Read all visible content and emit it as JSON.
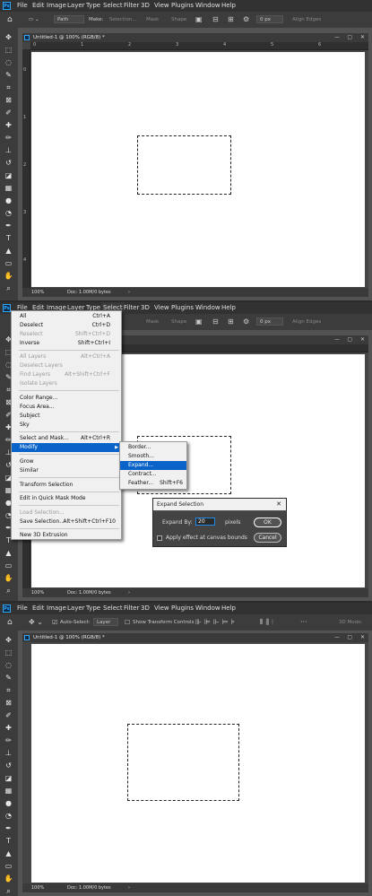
{
  "menu": [
    "File",
    "Edit",
    "Image",
    "Layer",
    "Type",
    "Select",
    "Filter",
    "3D",
    "View",
    "Plugins",
    "Window",
    "Help"
  ],
  "menu_logo": "Ps",
  "options_bar_1": {
    "path_label": "Path",
    "make_label": "Make:",
    "selection_btn": "Selection...",
    "mask_btn": "Mask",
    "shape_btn": "Shape",
    "radius_value": "0 px",
    "align_edges": "Align Edges"
  },
  "options_bar_3": {
    "auto_select": "Auto-Select:",
    "layer_value": "Layer",
    "show_transform": "Show Transform Controls",
    "mode_3d": "3D Mode:"
  },
  "document": {
    "title": "Untitled-1 @ 100% (RGB/8) *",
    "zoom": "100%",
    "doc_info": "Doc: 1.00M/0 bytes"
  },
  "ruler": {
    "top": [
      "0",
      "1",
      "2",
      "3",
      "4",
      "5",
      "6"
    ],
    "left": [
      "0",
      "1",
      "2",
      "3",
      "4"
    ]
  },
  "select_menu": [
    {
      "label": "All",
      "shortcut": "Ctrl+A",
      "state": "normal"
    },
    {
      "label": "Deselect",
      "shortcut": "Ctrl+D",
      "state": "normal"
    },
    {
      "label": "Reselect",
      "shortcut": "Shift+Ctrl+D",
      "state": "disabled"
    },
    {
      "label": "Inverse",
      "shortcut": "Shift+Ctrl+I",
      "state": "normal"
    },
    {
      "label": "All Layers",
      "shortcut": "Alt+Ctrl+A",
      "state": "disabled"
    },
    {
      "label": "Deselect Layers",
      "shortcut": "",
      "state": "disabled"
    },
    {
      "label": "Find Layers",
      "shortcut": "Alt+Shift+Ctrl+F",
      "state": "disabled"
    },
    {
      "label": "Isolate Layers",
      "shortcut": "",
      "state": "disabled"
    },
    {
      "label": "Color Range...",
      "shortcut": "",
      "state": "normal"
    },
    {
      "label": "Focus Area...",
      "shortcut": "",
      "state": "normal"
    },
    {
      "label": "Subject",
      "shortcut": "",
      "state": "normal"
    },
    {
      "label": "Sky",
      "shortcut": "",
      "state": "normal"
    },
    {
      "label": "Select and Mask...",
      "shortcut": "Alt+Ctrl+R",
      "state": "normal"
    },
    {
      "label": "Modify",
      "shortcut": "",
      "state": "highlighted"
    },
    {
      "label": "Grow",
      "shortcut": "",
      "state": "normal"
    },
    {
      "label": "Similar",
      "shortcut": "",
      "state": "normal"
    },
    {
      "label": "Transform Selection",
      "shortcut": "",
      "state": "normal"
    },
    {
      "label": "Edit in Quick Mask Mode",
      "shortcut": "",
      "state": "normal"
    },
    {
      "label": "Load Selection...",
      "shortcut": "",
      "state": "disabled"
    },
    {
      "label": "Save Selection...",
      "shortcut": "Alt+Shift+Ctrl+F10",
      "state": "normal"
    },
    {
      "label": "New 3D Extrusion",
      "shortcut": "",
      "state": "normal"
    }
  ],
  "modify_submenu": [
    {
      "label": "Border...",
      "shortcut": ""
    },
    {
      "label": "Smooth...",
      "shortcut": ""
    },
    {
      "label": "Expand...",
      "shortcut": ""
    },
    {
      "label": "Contract...",
      "shortcut": ""
    },
    {
      "label": "Feather...",
      "shortcut": "Shift+F6"
    }
  ],
  "expand_dialog": {
    "title": "Expand Selection",
    "expand_by_label": "Expand By:",
    "expand_by_value": "20",
    "unit": "pixels",
    "checkbox_label": "Apply effect at canvas bounds",
    "ok": "OK",
    "cancel": "Cancel"
  }
}
